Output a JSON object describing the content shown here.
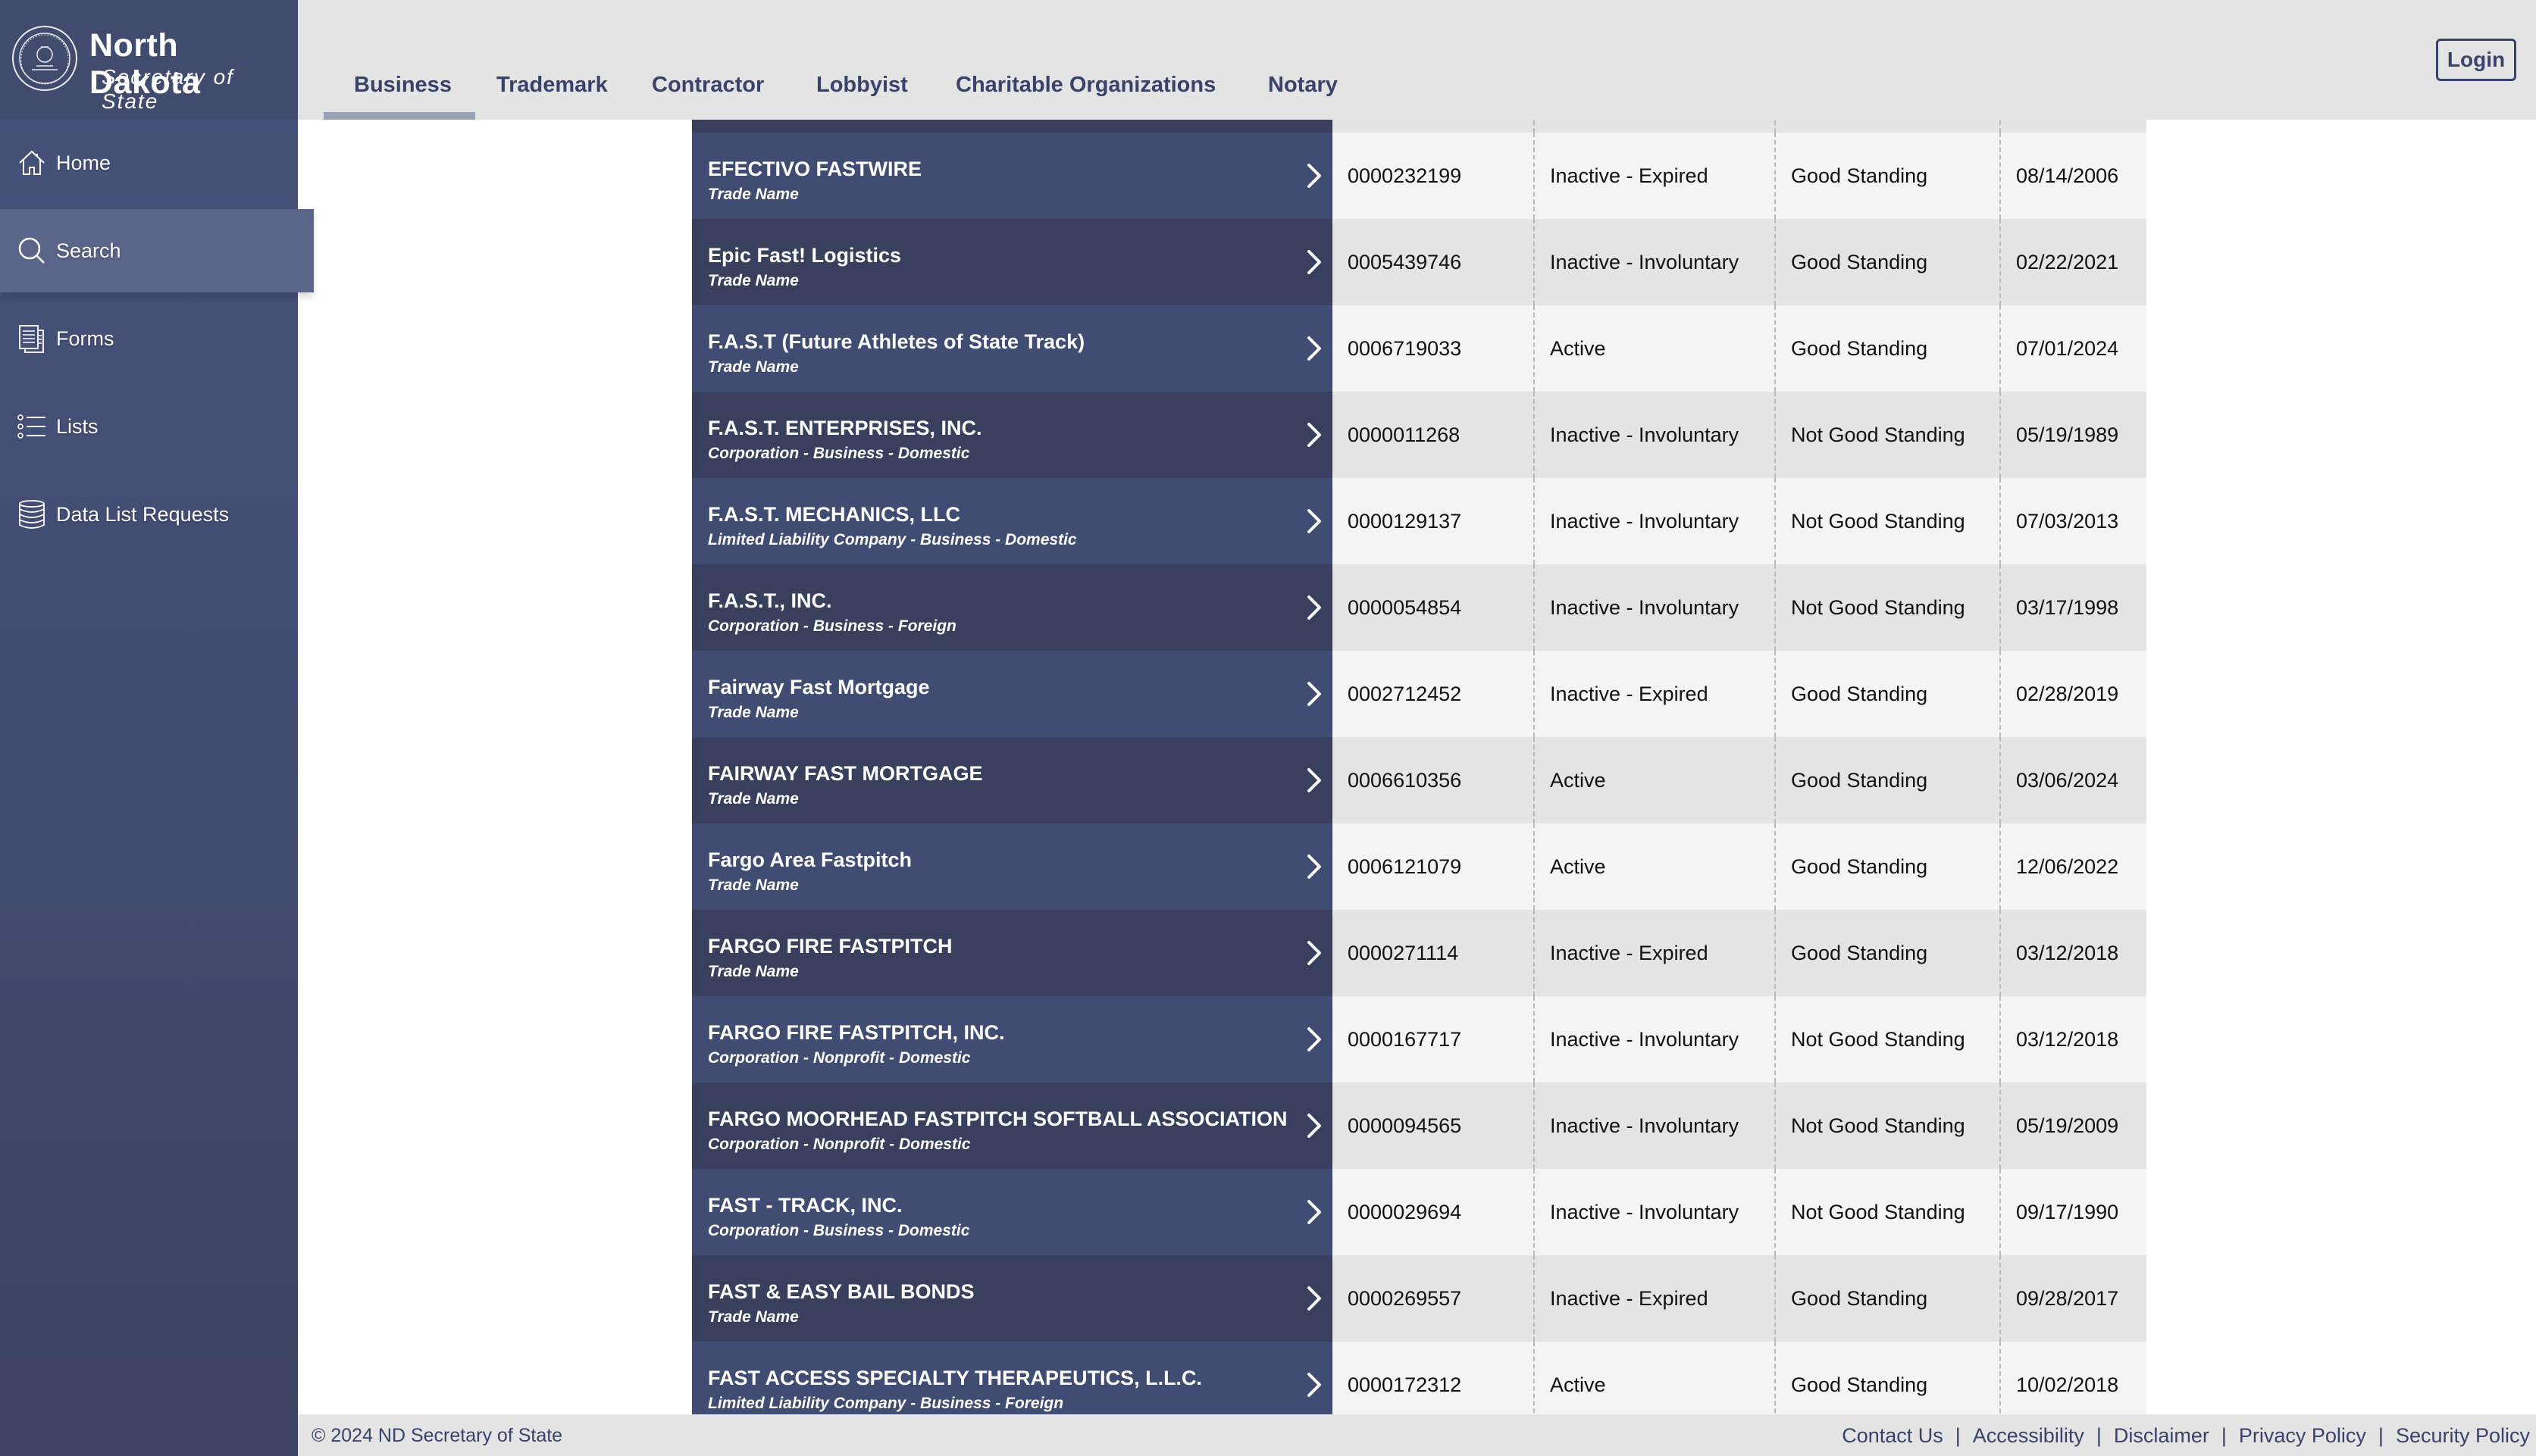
{
  "brand": {
    "title": "North Dakota",
    "subtitle": "Secretary of State",
    "seal_icon": "great-seal-icon"
  },
  "sidebar": {
    "items": [
      {
        "label": "Home",
        "icon": "home-icon",
        "active": false
      },
      {
        "label": "Search",
        "icon": "search-icon",
        "active": true
      },
      {
        "label": "Forms",
        "icon": "forms-icon",
        "active": false
      },
      {
        "label": "Lists",
        "icon": "list-icon",
        "active": false
      },
      {
        "label": "Data List Requests",
        "icon": "database-icon",
        "active": false
      }
    ]
  },
  "header": {
    "tabs": [
      {
        "label": "Business",
        "active": true
      },
      {
        "label": "Trademark",
        "active": false
      },
      {
        "label": "Contractor",
        "active": false
      },
      {
        "label": "Lobbyist",
        "active": false
      },
      {
        "label": "Charitable Organizations",
        "active": false
      },
      {
        "label": "Notary",
        "active": false
      }
    ],
    "login_label": "Login"
  },
  "results": {
    "rows": [
      {
        "name": "EFECTIVO FASTWIRE",
        "type": "Trade Name",
        "id": "0000232199",
        "status": "Inactive - Expired",
        "standing": "Good Standing",
        "date": "08/14/2006"
      },
      {
        "name": "Epic Fast! Logistics",
        "type": "Trade Name",
        "id": "0005439746",
        "status": "Inactive - Involuntary",
        "standing": "Good Standing",
        "date": "02/22/2021"
      },
      {
        "name": "F.A.S.T (Future Athletes of State Track)",
        "type": "Trade Name",
        "id": "0006719033",
        "status": "Active",
        "standing": "Good Standing",
        "date": "07/01/2024"
      },
      {
        "name": "F.A.S.T. ENTERPRISES, INC.",
        "type": "Corporation - Business - Domestic",
        "id": "0000011268",
        "status": "Inactive - Involuntary",
        "standing": "Not Good Standing",
        "date": "05/19/1989"
      },
      {
        "name": "F.A.S.T. MECHANICS, LLC",
        "type": "Limited Liability Company - Business - Domestic",
        "id": "0000129137",
        "status": "Inactive - Involuntary",
        "standing": "Not Good Standing",
        "date": "07/03/2013"
      },
      {
        "name": "F.A.S.T., INC.",
        "type": "Corporation - Business - Foreign",
        "id": "0000054854",
        "status": "Inactive - Involuntary",
        "standing": "Not Good Standing",
        "date": "03/17/1998"
      },
      {
        "name": "Fairway Fast Mortgage",
        "type": "Trade Name",
        "id": "0002712452",
        "status": "Inactive - Expired",
        "standing": "Good Standing",
        "date": "02/28/2019"
      },
      {
        "name": "FAIRWAY FAST MORTGAGE",
        "type": "Trade Name",
        "id": "0006610356",
        "status": "Active",
        "standing": "Good Standing",
        "date": "03/06/2024"
      },
      {
        "name": "Fargo Area Fastpitch",
        "type": "Trade Name",
        "id": "0006121079",
        "status": "Active",
        "standing": "Good Standing",
        "date": "12/06/2022"
      },
      {
        "name": "FARGO FIRE FASTPITCH",
        "type": "Trade Name",
        "id": "0000271114",
        "status": "Inactive - Expired",
        "standing": "Good Standing",
        "date": "03/12/2018"
      },
      {
        "name": "FARGO FIRE FASTPITCH, INC.",
        "type": "Corporation - Nonprofit - Domestic",
        "id": "0000167717",
        "status": "Inactive - Involuntary",
        "standing": "Not Good Standing",
        "date": "03/12/2018"
      },
      {
        "name": "FARGO MOORHEAD FASTPITCH SOFTBALL ASSOCIATION",
        "type": "Corporation - Nonprofit - Domestic",
        "id": "0000094565",
        "status": "Inactive - Involuntary",
        "standing": "Not Good Standing",
        "date": "05/19/2009"
      },
      {
        "name": "FAST - TRACK, INC.",
        "type": "Corporation - Business - Domestic",
        "id": "0000029694",
        "status": "Inactive - Involuntary",
        "standing": "Not Good Standing",
        "date": "09/17/1990"
      },
      {
        "name": "FAST & EASY BAIL BONDS",
        "type": "Trade Name",
        "id": "0000269557",
        "status": "Inactive - Expired",
        "standing": "Good Standing",
        "date": "09/28/2017"
      },
      {
        "name": "FAST ACCESS SPECIALTY THERAPEUTICS, L.L.C.",
        "type": "Limited Liability Company - Business - Foreign",
        "id": "0000172312",
        "status": "Active",
        "standing": "Good Standing",
        "date": "10/02/2018"
      }
    ]
  },
  "footer": {
    "copyright": "© 2024 ND Secretary of State",
    "links": [
      "Contact Us",
      "Accessibility",
      "Disclaimer",
      "Privacy Policy",
      "Security Policy"
    ],
    "separator": "|"
  },
  "colors": {
    "brand_navy": "#39426a",
    "sidebar_bg": "#434e74",
    "sidebar_active": "#5a6589",
    "row_name_light": "#414c72",
    "row_name_dark": "#39405e",
    "row_data_light": "#f4f4f4",
    "row_data_dark": "#e4e4e4",
    "header_bg": "#e4e4e4"
  }
}
